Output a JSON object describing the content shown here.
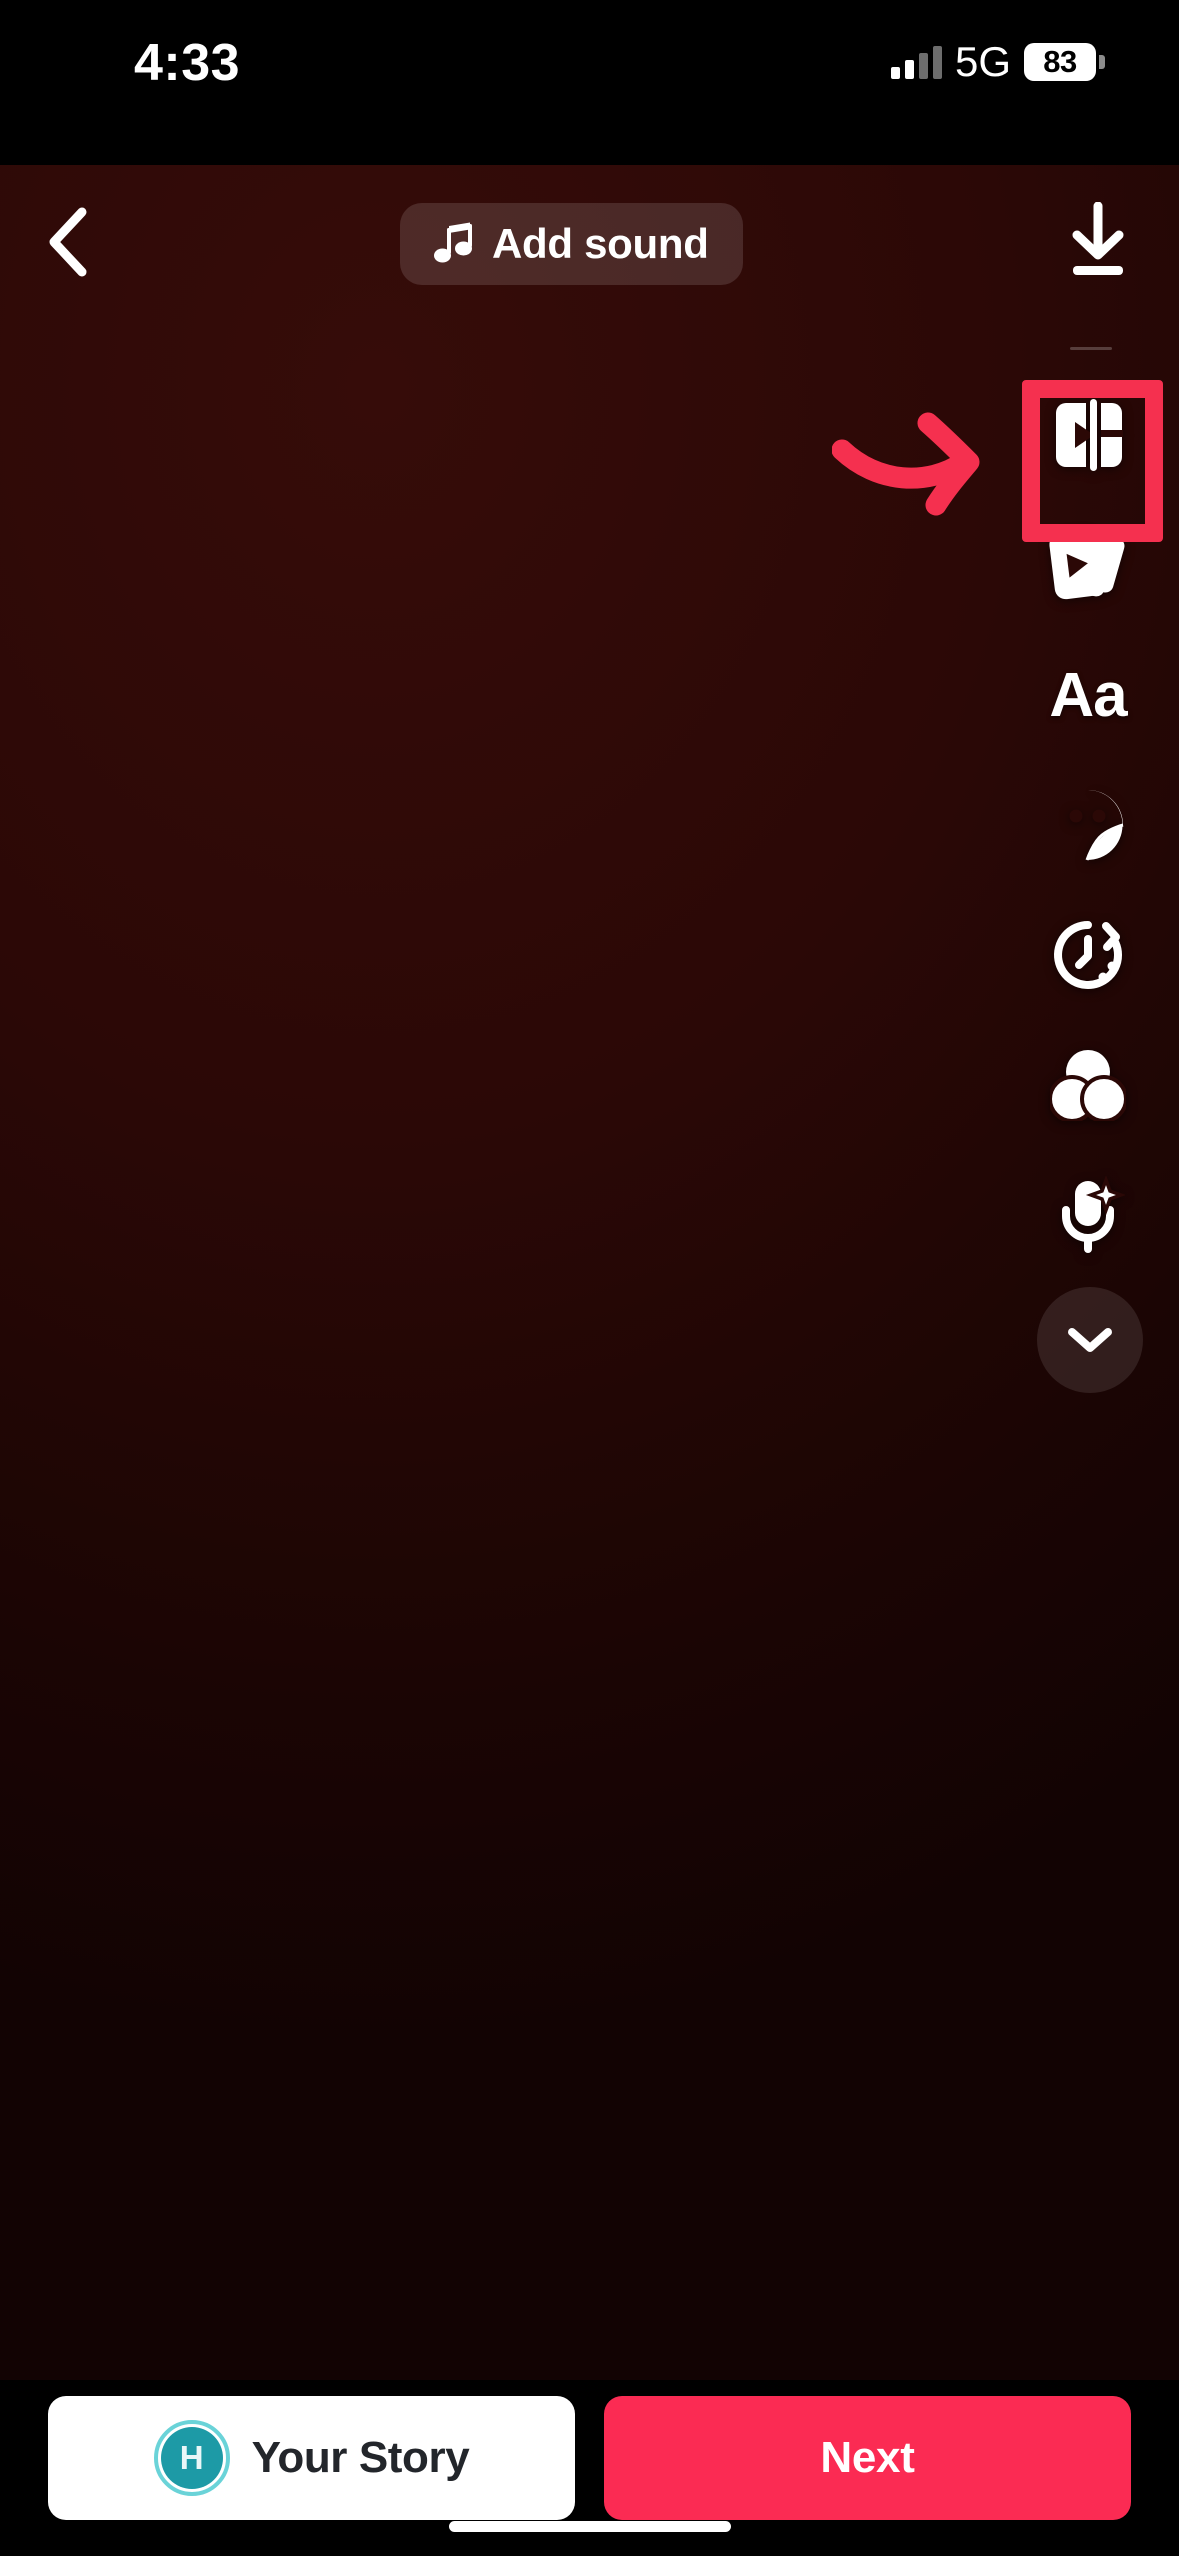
{
  "status_bar": {
    "time": "4:33",
    "network": "5G",
    "battery_percent": "83",
    "signal_icon": "cellular-signal-icon",
    "battery_icon": "battery-icon"
  },
  "top_toolbar": {
    "back_icon": "chevron-left-icon",
    "add_sound": {
      "label": "Add sound",
      "icon": "music-note-icon"
    },
    "download_icon": "download-icon"
  },
  "tool_rail": {
    "items": [
      {
        "name": "clip-split",
        "icon": "clip-split-icon",
        "highlighted": true
      },
      {
        "name": "templates",
        "icon": "template-cards-icon",
        "highlighted": false
      },
      {
        "name": "text",
        "icon": "text-aa-icon",
        "label": "Aa",
        "highlighted": false
      },
      {
        "name": "stickers",
        "icon": "sticker-face-icon",
        "highlighted": false
      },
      {
        "name": "timer",
        "icon": "clock-timer-icon",
        "highlighted": false
      },
      {
        "name": "filters",
        "icon": "filters-circles-icon",
        "highlighted": false
      },
      {
        "name": "voice-effects",
        "icon": "microphone-sparkle-icon",
        "highlighted": false
      }
    ],
    "collapse_icon": "chevron-down-icon"
  },
  "annotation": {
    "arrow_icon": "curved-arrow-right-icon",
    "arrow_color": "#f5304f",
    "highlight_color": "#f5304f"
  },
  "bottom_bar": {
    "story_button": {
      "label": "Your Story",
      "avatar_initial": "H",
      "avatar_color": "#1d9aa6",
      "ring_color": "#6ad3d8"
    },
    "next_button": {
      "label": "Next",
      "color": "#fb2b53"
    },
    "home_indicator": "home-indicator"
  },
  "canvas": {
    "background_color": "#2b0806"
  }
}
